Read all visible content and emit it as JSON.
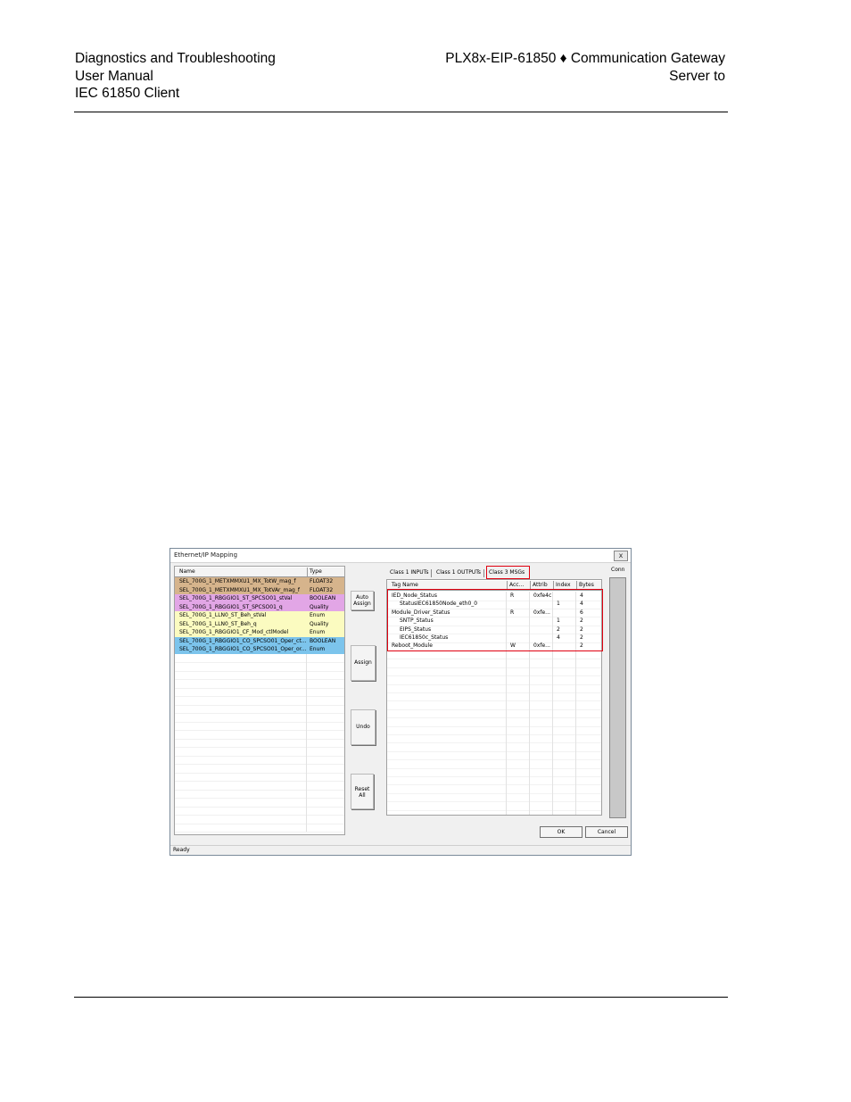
{
  "header": {
    "left": [
      "Diagnostics and Troubleshooting",
      "User Manual",
      "IEC 61850 Client"
    ],
    "right": [
      "PLX8x-EIP-61850 ♦ Communication Gateway",
      "Server to"
    ]
  },
  "dialog": {
    "title": "Ethernet/IP Mapping",
    "close_label": "x",
    "left_table": {
      "columns": [
        "Name",
        "Type"
      ],
      "rows": [
        {
          "name": "SEL_700G_1_METXMMXU1_MX_TotW_mag_f",
          "type": "FLOAT32",
          "color": "#d6b48c"
        },
        {
          "name": "SEL_700G_1_METXMMXU1_MX_TotVAr_mag_f",
          "type": "FLOAT32",
          "color": "#d6b48c"
        },
        {
          "name": "SEL_700G_1_RBGGIO1_ST_SPCSO01_stVal",
          "type": "BOOLEAN",
          "color": "#e2a6e6"
        },
        {
          "name": "SEL_700G_1_RBGGIO1_ST_SPCSO01_q",
          "type": "Quality",
          "color": "#e2a6e6"
        },
        {
          "name": "SEL_700G_1_LLN0_ST_Beh_stVal",
          "type": "Enum",
          "color": "#fbfbc0"
        },
        {
          "name": "SEL_700G_1_LLN0_ST_Beh_q",
          "type": "Quality",
          "color": "#fbfbc0"
        },
        {
          "name": "SEL_700G_1_RBGGIO1_CF_Mod_ctlModel",
          "type": "Enum",
          "color": "#fbfbc0"
        },
        {
          "name": "SEL_700G_1_RBGGIO1_CO_SPCSO01_Oper_ct...",
          "type": "BOOLEAN",
          "color": "#7cc4ec"
        },
        {
          "name": "SEL_700G_1_RBGGIO1_CO_SPCSO01_Oper_or...",
          "type": "Enum",
          "color": "#7cc4ec"
        }
      ]
    },
    "buttons": {
      "auto_assign": [
        "Auto",
        "Assign"
      ],
      "assign": [
        "Assign"
      ],
      "undo": [
        "Undo"
      ],
      "reset_all": [
        "Reset",
        "All"
      ]
    },
    "tabs": [
      "Class 1 INPUTs",
      "Class 1 OUTPUTs",
      "Class 3 MSGs"
    ],
    "active_tab": "Class 3 MSGs",
    "msg_table": {
      "columns": [
        "Tag Name",
        "Acc...",
        "Attrib",
        "Index",
        "Bytes"
      ],
      "rows": [
        {
          "tag": "IED_Node_Status",
          "indent": 0,
          "acc": "R",
          "attrib": "0xfe4c",
          "index": "",
          "bytes": "4"
        },
        {
          "tag": "StatusIEC61850Node_eth0_0",
          "indent": 1,
          "acc": "",
          "attrib": "",
          "index": "1",
          "bytes": "4"
        },
        {
          "tag": "Module_Driver_Status",
          "indent": 0,
          "acc": "R",
          "attrib": "0xfe...",
          "index": "",
          "bytes": "6"
        },
        {
          "tag": "SNTP_Status",
          "indent": 1,
          "acc": "",
          "attrib": "",
          "index": "1",
          "bytes": "2"
        },
        {
          "tag": "EIPS_Status",
          "indent": 1,
          "acc": "",
          "attrib": "",
          "index": "2",
          "bytes": "2"
        },
        {
          "tag": "IEC61850c_Status",
          "indent": 1,
          "acc": "",
          "attrib": "",
          "index": "4",
          "bytes": "2"
        },
        {
          "tag": "Reboot_Module",
          "indent": 0,
          "acc": "W",
          "attrib": "0xfe...",
          "index": "",
          "bytes": "2"
        }
      ]
    },
    "conn_label": "Conn",
    "ok_label": "OK",
    "cancel_label": "Cancel",
    "status": "Ready",
    "highlight_color": "#e00010"
  }
}
